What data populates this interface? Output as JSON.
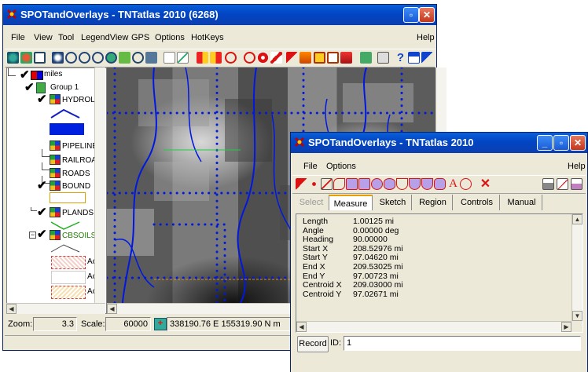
{
  "main_window": {
    "title": "SPOTandOverlays - TNTatlas 2010 (6268)",
    "menu": [
      "File",
      "View",
      "Tool",
      "LegendView",
      "GPS",
      "Options",
      "HotKeys",
      "Help"
    ],
    "legend": {
      "scale_label": "miles",
      "group_label": "Group 1",
      "layers": [
        {
          "name": "HYDROLO",
          "checked": true
        },
        {
          "name": "PIPELINE",
          "checked": false
        },
        {
          "name": "RAILROA",
          "checked": false
        },
        {
          "name": "ROADS",
          "checked": false
        },
        {
          "name": "BOUND",
          "checked": true
        },
        {
          "name": "PLANDS",
          "checked": true
        },
        {
          "name": "CBSOILS",
          "checked": true
        }
      ],
      "soil_items": [
        "Ac",
        "Ac",
        "Ac"
      ]
    },
    "status": {
      "zoom_label": "Zoom:",
      "zoom_value": "3.3",
      "scale_label": "Scale:",
      "scale_value": "60000",
      "coordinates": "338190.76 E 155319.90 N m"
    }
  },
  "measure_window": {
    "title": "SPOTandOverlays - TNTatlas 2010",
    "menu": [
      "File",
      "Options",
      "Help"
    ],
    "tabs": [
      "Select",
      "Measure",
      "Sketch",
      "Region",
      "Controls",
      "Manual"
    ],
    "active_tab": "Measure",
    "measurements": [
      {
        "label": "Length",
        "value": "1.00125 mi"
      },
      {
        "label": "Angle",
        "value": "0.00000 deg"
      },
      {
        "label": "Heading",
        "value": "90.00000"
      },
      {
        "label": "Start X",
        "value": "208.52976 mi"
      },
      {
        "label": "Start Y",
        "value": "97.04620 mi"
      },
      {
        "label": "End X",
        "value": "209.53025 mi"
      },
      {
        "label": "End Y",
        "value": "97.00723 mi"
      },
      {
        "label": "Centroid X",
        "value": "209.03000 mi"
      },
      {
        "label": "Centroid Y",
        "value": "97.02671 mi"
      }
    ],
    "record_button": "Record",
    "id_label": "ID:",
    "id_value": "1"
  }
}
